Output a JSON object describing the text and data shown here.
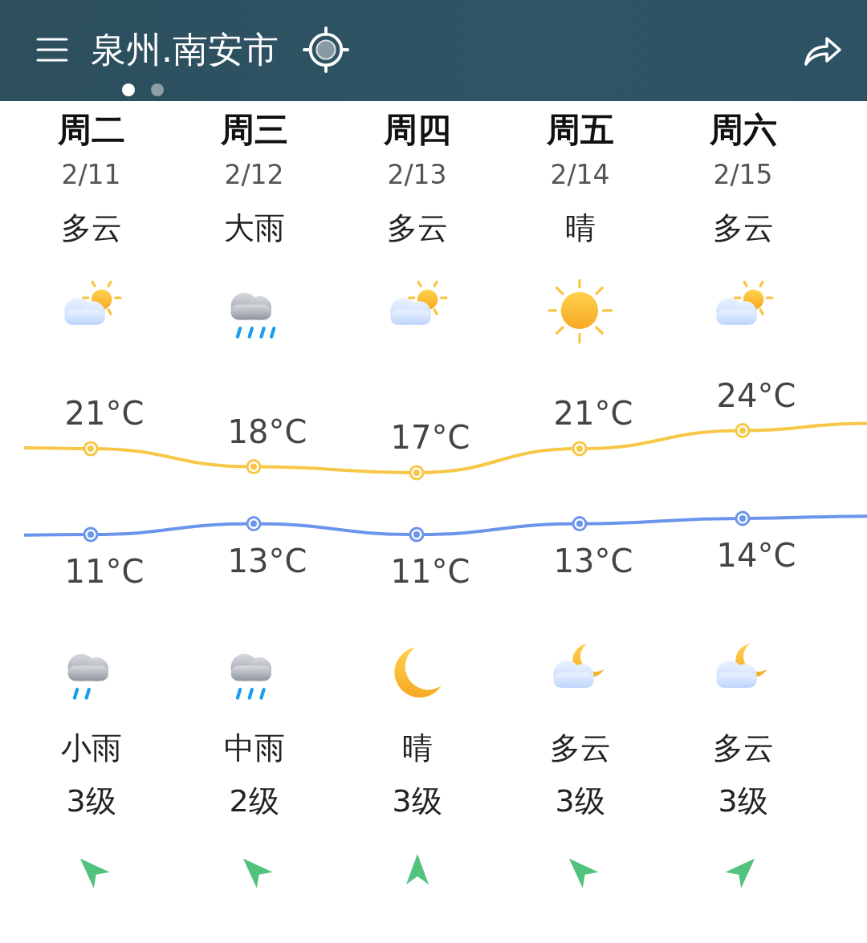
{
  "header": {
    "city": "泉州.南安市",
    "pages": [
      {
        "selected": true
      },
      {
        "selected": false
      }
    ]
  },
  "days": [
    {
      "weekday": "周二",
      "date": "2/11",
      "day_weather": "多云",
      "day_icon": {
        "kind": "partlycloudy"
      },
      "high": "21°C",
      "low": "11°C",
      "night_icon": {
        "kind": "lightrain"
      },
      "night_weather": "小雨",
      "wind_level": "3级",
      "wind_arrow": {
        "kind": "northwest"
      }
    },
    {
      "weekday": "周三",
      "date": "2/12",
      "day_weather": "大雨",
      "day_icon": {
        "kind": "heavyrain"
      },
      "high": "18°C",
      "low": "13°C",
      "night_icon": {
        "kind": "moderaterain"
      },
      "night_weather": "中雨",
      "wind_level": "2级",
      "wind_arrow": {
        "kind": "northwest"
      }
    },
    {
      "weekday": "周四",
      "date": "2/13",
      "day_weather": "多云",
      "day_icon": {
        "kind": "partlycloudy"
      },
      "high": "17°C",
      "low": "11°C",
      "night_icon": {
        "kind": "moon"
      },
      "night_weather": "晴",
      "wind_level": "3级",
      "wind_arrow": {
        "kind": "north"
      }
    },
    {
      "weekday": "周五",
      "date": "2/14",
      "day_weather": "晴",
      "day_icon": {
        "kind": "sunny"
      },
      "high": "21°C",
      "low": "13°C",
      "night_icon": {
        "kind": "mooncloud"
      },
      "night_weather": "多云",
      "wind_level": "3级",
      "wind_arrow": {
        "kind": "northwest"
      }
    },
    {
      "weekday": "周六",
      "date": "2/15",
      "day_weather": "多云",
      "day_icon": {
        "kind": "partlycloudy"
      },
      "high": "24°C",
      "low": "14°C",
      "night_icon": {
        "kind": "mooncloud"
      },
      "night_weather": "多云",
      "wind_level": "3级",
      "wind_arrow": {
        "kind": "northeast"
      }
    }
  ]
}
